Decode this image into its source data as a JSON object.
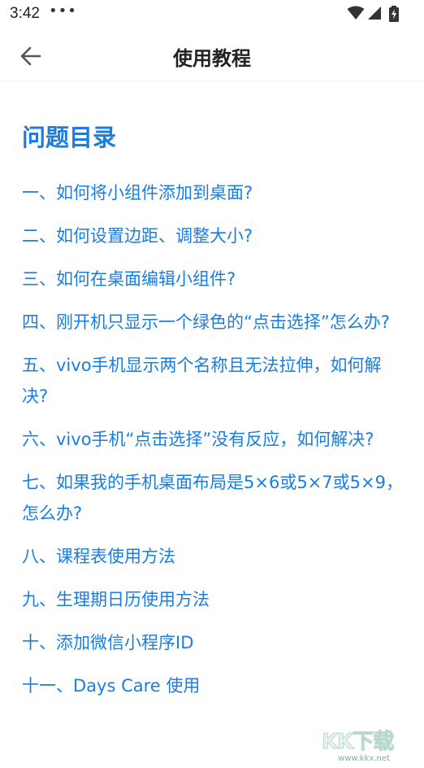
{
  "status_bar": {
    "time": "3:42",
    "dots": "•••",
    "icons": [
      "wifi-icon",
      "signal-icon",
      "battery-charging-icon"
    ]
  },
  "app_bar": {
    "back_icon": "arrow-left-icon",
    "title": "使用教程"
  },
  "content": {
    "section_title": "问题目录",
    "items": [
      "一、如何将小组件添加到桌面?",
      "二、如何设置边距、调整大小?",
      "三、如何在桌面编辑小组件?",
      "四、刚开机只显示一个绿色的“点击选择”怎么办?",
      "五、vivo手机显示两个名称且无法拉伸，如何解决?",
      "六、vivo手机“点击选择”没有反应，如何解决?",
      "七、如果我的手机桌面布局是5×6或5×7或5×9，怎么办?",
      "八、课程表使用方法",
      "九、生理期日历使用方法",
      "十、添加微信小程序ID",
      "十一、Days Care 使用"
    ]
  },
  "watermark": {
    "logo": "KK下载",
    "url": "www.kkx.net"
  },
  "colors": {
    "accent": "#1a7de0",
    "title_text": "#222222",
    "background": "#ffffff"
  }
}
